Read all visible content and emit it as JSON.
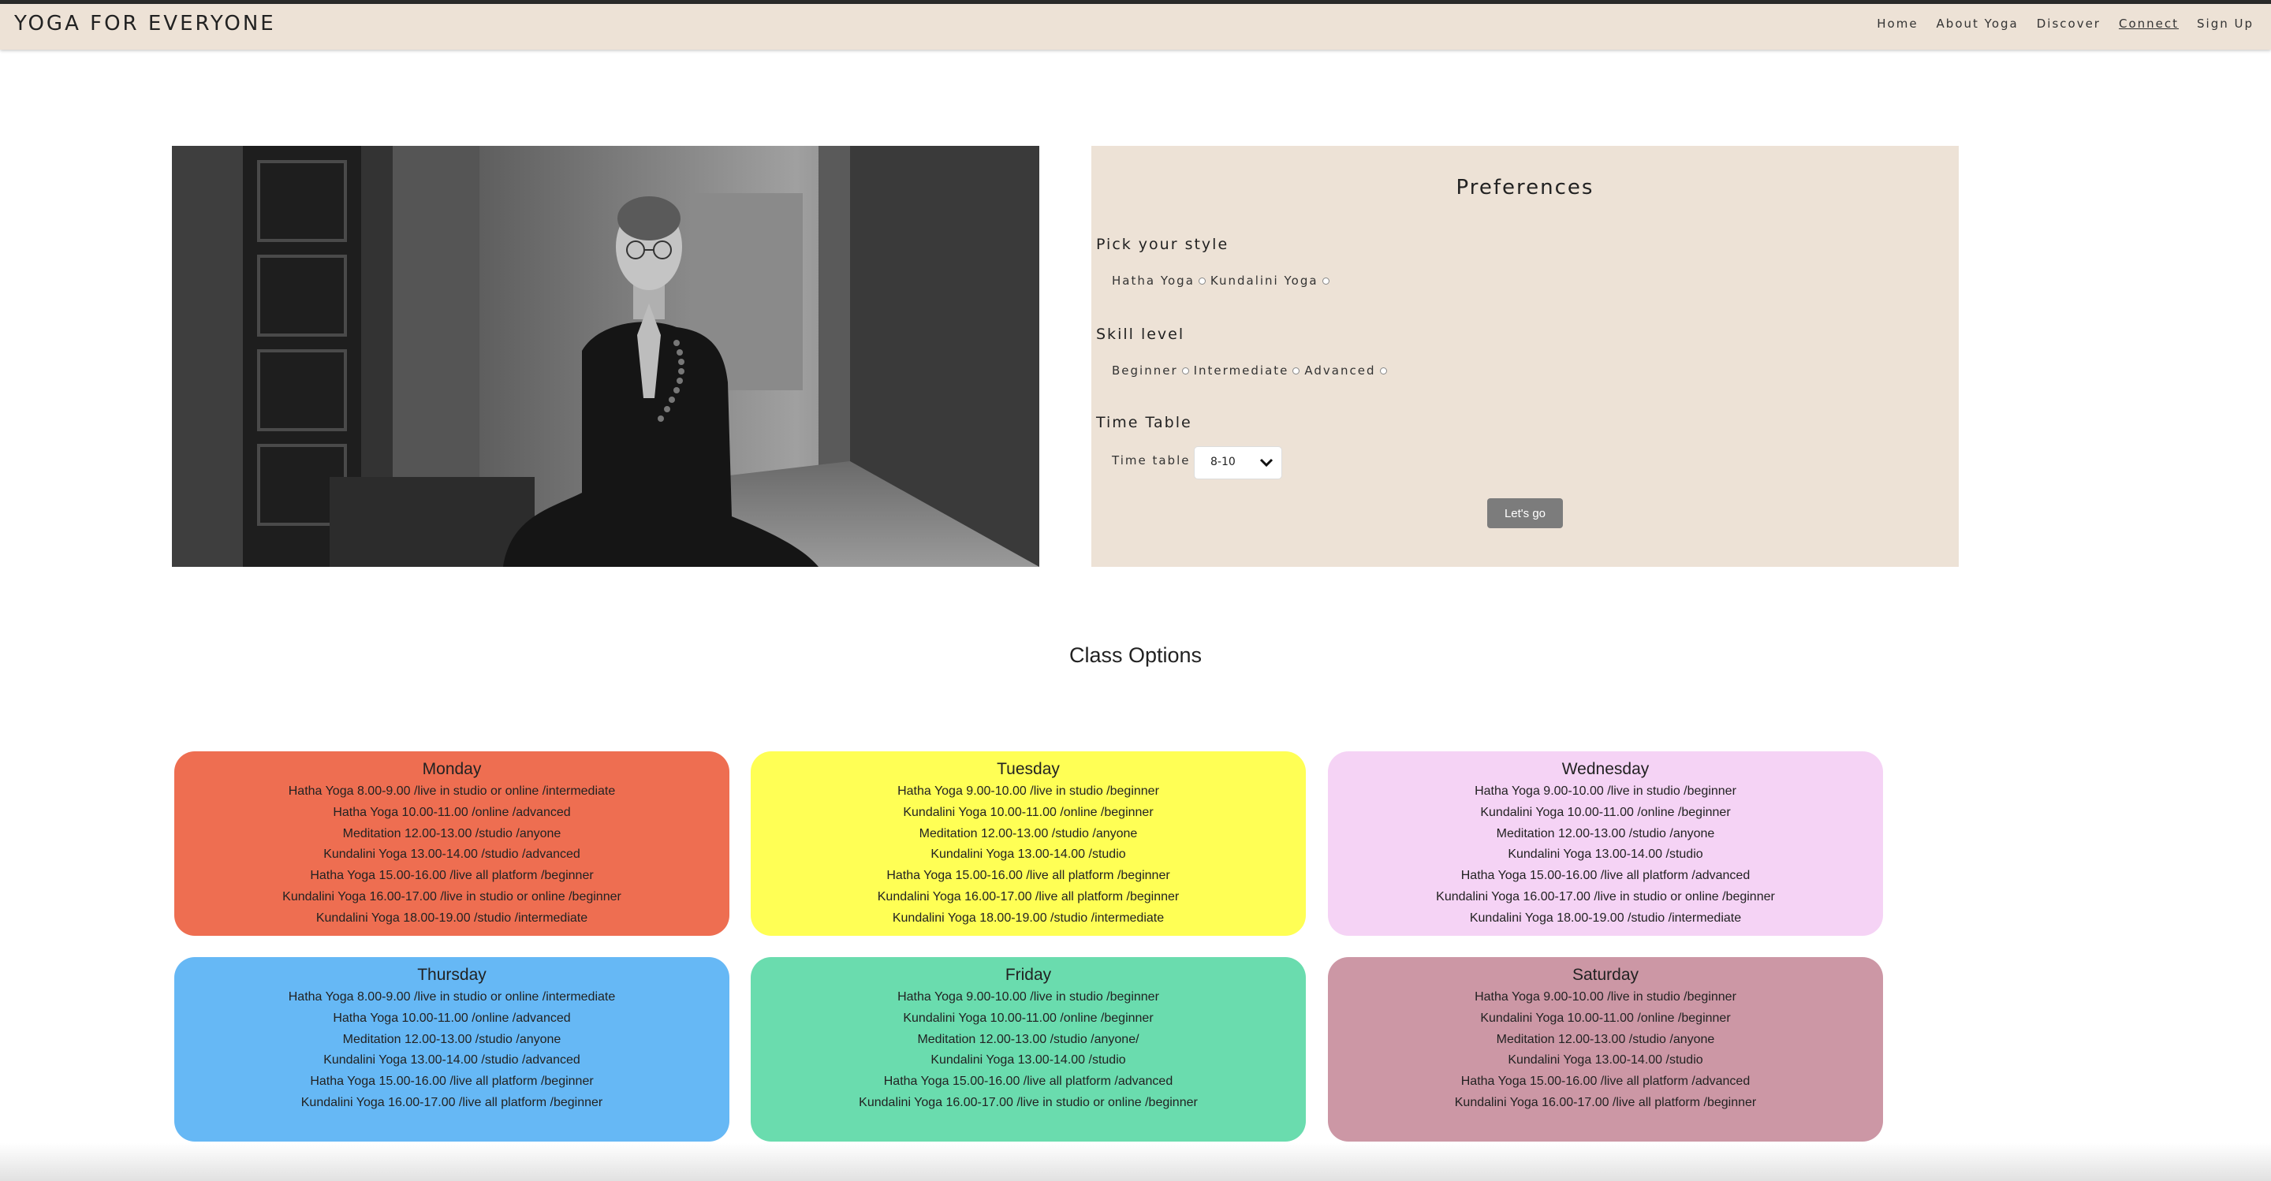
{
  "brand": "YOGA FOR EVERYONE",
  "nav": [
    "Home",
    "About Yoga",
    "Discover",
    "Connect",
    "Sign Up"
  ],
  "nav_active": "Connect",
  "hero_image_alt": "Monk meditating in prayer pose",
  "preferences": {
    "title": "Preferences",
    "style_label": "Pick your style",
    "style_options": [
      "Hatha Yoga",
      "Kundalini Yoga"
    ],
    "skill_label": "Skill level",
    "skill_options": [
      "Beginner",
      "Intermediate",
      "Advanced"
    ],
    "timetable_label": "Time Table",
    "timetable_field_label": "Time table",
    "timetable_value": "8-10",
    "button": "Let's go"
  },
  "class_title": "Class Options",
  "days": [
    {
      "name": "Monday",
      "color": "#ee6e51",
      "lines": [
        "Hatha Yoga 8.00-9.00 /live in studio or online /intermediate",
        "Hatha Yoga 10.00-11.00 /online /advanced",
        "Meditation 12.00-13.00 /studio /anyone",
        "Kundalini Yoga 13.00-14.00 /studio /advanced",
        "Hatha Yoga 15.00-16.00 /live all platform /beginner",
        "Kundalini Yoga 16.00-17.00 /live in studio or online /beginner",
        "Kundalini Yoga 18.00-19.00 /studio /intermediate"
      ]
    },
    {
      "name": "Tuesday",
      "color": "#ffff55",
      "lines": [
        "Hatha Yoga 9.00-10.00 /live in studio /beginner",
        "Kundalini Yoga 10.00-11.00 /online /beginner",
        "Meditation 12.00-13.00 /studio /anyone",
        "Kundalini Yoga 13.00-14.00 /studio",
        "Hatha Yoga 15.00-16.00 /live all platform /beginner",
        "Kundalini Yoga 16.00-17.00 /live all platform /beginner",
        "Kundalini Yoga 18.00-19.00 /studio /intermediate"
      ]
    },
    {
      "name": "Wednesday",
      "color": "#f5d3f5",
      "lines": [
        "Hatha Yoga 9.00-10.00 /live in studio /beginner",
        "Kundalini Yoga 10.00-11.00 /online /beginner",
        "Meditation 12.00-13.00 /studio /anyone",
        "Kundalini Yoga 13.00-14.00 /studio",
        "Hatha Yoga 15.00-16.00 /live all platform /advanced",
        "Kundalini Yoga 16.00-17.00 /live in studio or online /beginner",
        "Kundalini Yoga 18.00-19.00 /studio /intermediate"
      ]
    },
    {
      "name": "Thursday",
      "color": "#66b8f5",
      "lines": [
        "Hatha Yoga 8.00-9.00 /live in studio or online /intermediate",
        "Hatha Yoga 10.00-11.00 /online /advanced",
        "Meditation 12.00-13.00 /studio /anyone",
        "Kundalini Yoga 13.00-14.00 /studio /advanced",
        "Hatha Yoga 15.00-16.00 /live all platform /beginner",
        "Kundalini Yoga 16.00-17.00 /live all platform /beginner"
      ]
    },
    {
      "name": "Friday",
      "color": "#6adcae",
      "lines": [
        "Hatha Yoga 9.00-10.00 /live in studio /beginner",
        "Kundalini Yoga 10.00-11.00 /online /beginner",
        "Meditation 12.00-13.00 /studio /anyone/",
        "Kundalini Yoga 13.00-14.00 /studio",
        "Hatha Yoga 15.00-16.00 /live all platform /advanced",
        "Kundalini Yoga 16.00-17.00 /live in studio or online /beginner"
      ]
    },
    {
      "name": "Saturday",
      "color": "#cc97a5",
      "lines": [
        "Hatha Yoga 9.00-10.00 /live in studio /beginner",
        "Kundalini Yoga 10.00-11.00 /online /beginner",
        "Meditation 12.00-13.00 /studio /anyone",
        "Kundalini Yoga 13.00-14.00 /studio",
        "Hatha Yoga 15.00-16.00 /live all platform /advanced",
        "Kundalini Yoga 16.00-17.00 /live all platform /beginner"
      ]
    }
  ]
}
